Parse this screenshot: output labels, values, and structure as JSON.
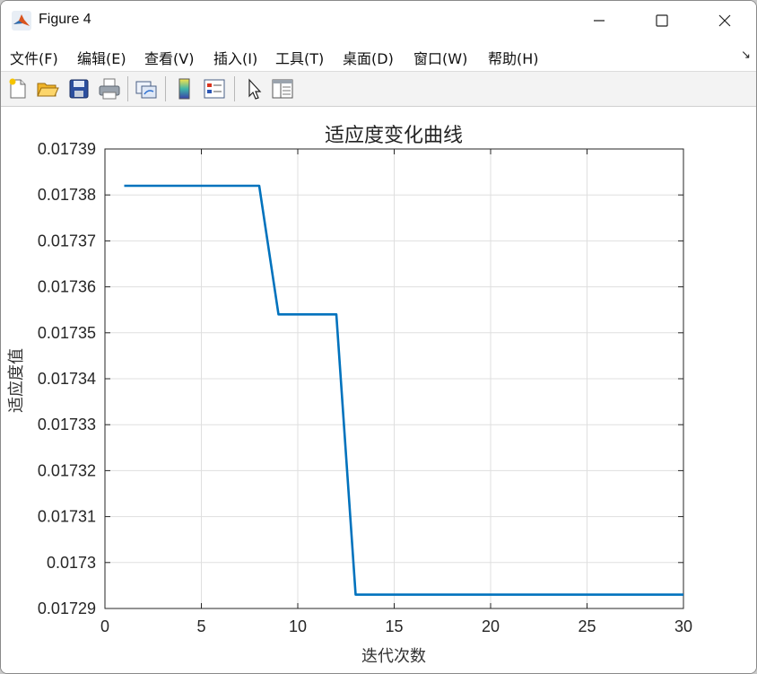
{
  "window": {
    "title": "Figure 4",
    "controls": {
      "minimize": "minimize-icon",
      "maximize": "maximize-icon",
      "close": "close-icon"
    }
  },
  "menu": {
    "items": [
      {
        "label": "文件(F)"
      },
      {
        "label": "编辑(E)"
      },
      {
        "label": "查看(V)"
      },
      {
        "label": "插入(I)"
      },
      {
        "label": "工具(T)"
      },
      {
        "label": "桌面(D)"
      },
      {
        "label": "窗口(W)"
      },
      {
        "label": "帮助(H)"
      }
    ],
    "dock_glyph": "↘"
  },
  "toolbar": {
    "buttons": [
      {
        "icon": "new-figure-icon"
      },
      {
        "icon": "open-file-icon"
      },
      {
        "icon": "save-icon"
      },
      {
        "icon": "print-icon"
      },
      {
        "icon": "link-plot-icon"
      },
      {
        "icon": "insert-colorbar-icon"
      },
      {
        "icon": "insert-legend-icon"
      },
      {
        "icon": "edit-plot-pointer-icon"
      },
      {
        "icon": "property-inspector-icon"
      }
    ]
  },
  "colors": {
    "line": "#0072BD",
    "grid": "#dfdfdf",
    "axes": "#262626"
  },
  "chart_data": {
    "type": "line",
    "title": "适应度变化曲线",
    "xlabel": "迭代次数",
    "ylabel": "适应度值",
    "xlim": [
      0,
      30
    ],
    "ylim": [
      0.01729,
      0.01739
    ],
    "xticks": [
      0,
      5,
      10,
      15,
      20,
      25,
      30
    ],
    "xtick_labels": [
      "0",
      "5",
      "10",
      "15",
      "20",
      "25",
      "30"
    ],
    "yticks": [
      0.01729,
      0.0173,
      0.01731,
      0.01732,
      0.01733,
      0.01734,
      0.01735,
      0.01736,
      0.01737,
      0.01738,
      0.01739
    ],
    "ytick_labels": [
      "0.01729",
      "0.0173",
      "0.01731",
      "0.01732",
      "0.01733",
      "0.01734",
      "0.01735",
      "0.01736",
      "0.01737",
      "0.01738",
      "0.01739"
    ],
    "grid": true,
    "series": [
      {
        "x": [
          1,
          2,
          3,
          4,
          5,
          6,
          7,
          8,
          9,
          10,
          11,
          12,
          13,
          14,
          15,
          16,
          17,
          18,
          19,
          20,
          21,
          22,
          23,
          24,
          25,
          26,
          27,
          28,
          29,
          30
        ],
        "y": [
          0.017382,
          0.017382,
          0.017382,
          0.017382,
          0.017382,
          0.017382,
          0.017382,
          0.017382,
          0.017354,
          0.017354,
          0.017354,
          0.017354,
          0.017293,
          0.017293,
          0.017293,
          0.017293,
          0.017293,
          0.017293,
          0.017293,
          0.017293,
          0.017293,
          0.017293,
          0.017293,
          0.017293,
          0.017293,
          0.017293,
          0.017293,
          0.017293,
          0.017293,
          0.017293
        ]
      }
    ]
  }
}
